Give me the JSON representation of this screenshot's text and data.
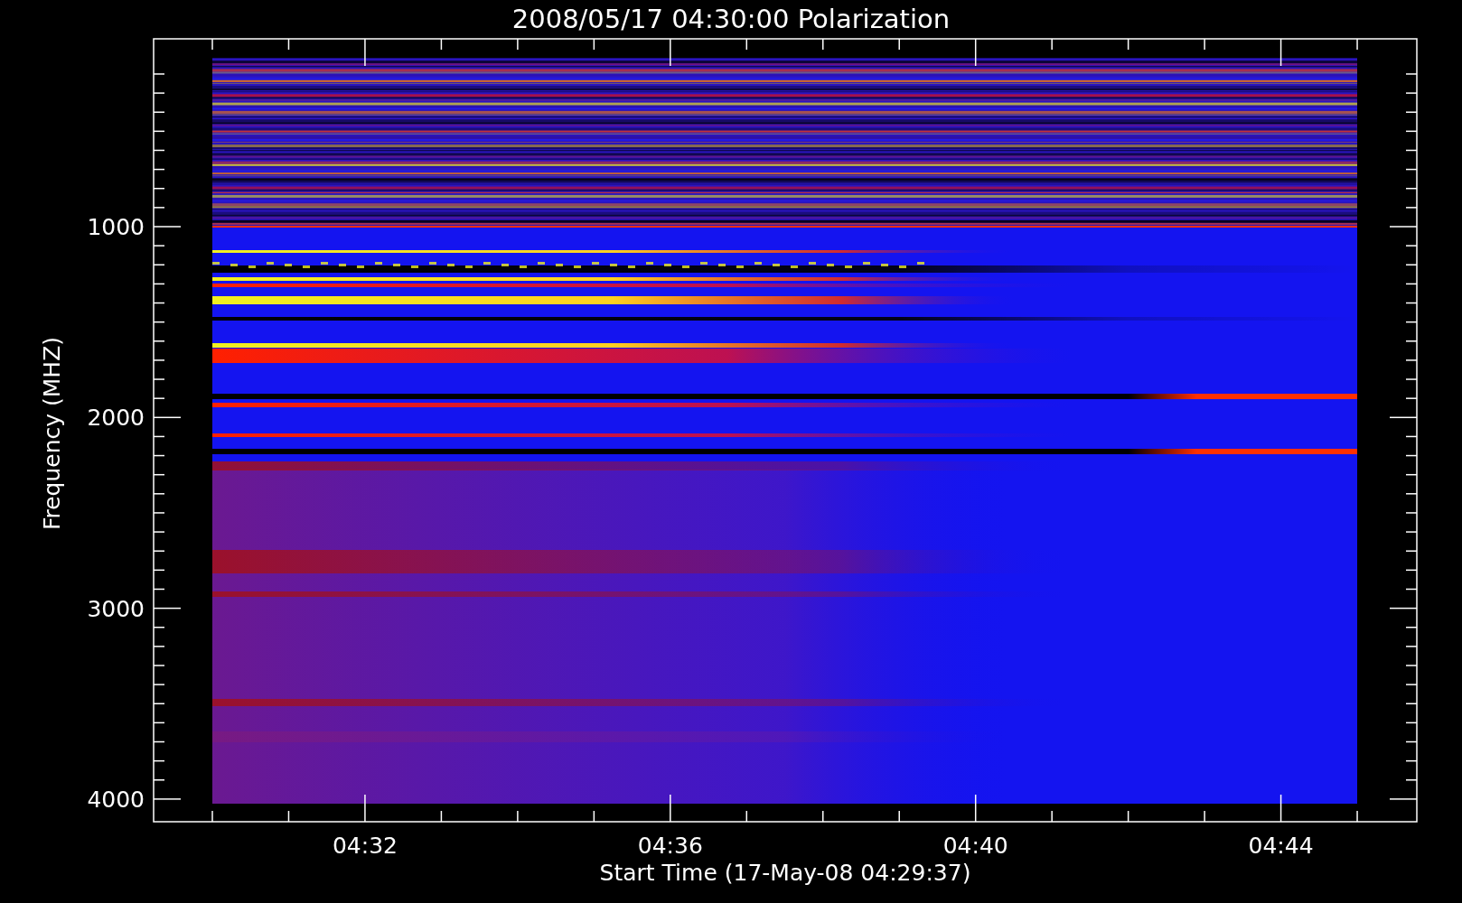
{
  "title": "2008/05/17 04:30:00 Polarization",
  "y_axis": {
    "label": "Frequency (MHZ)",
    "ticks": [
      "1000",
      "2000",
      "3000",
      "4000"
    ]
  },
  "x_axis": {
    "label": "Start Time (17-May-08 04:29:37)",
    "ticks": [
      "04:32",
      "04:36",
      "04:40",
      "04:44"
    ]
  }
}
